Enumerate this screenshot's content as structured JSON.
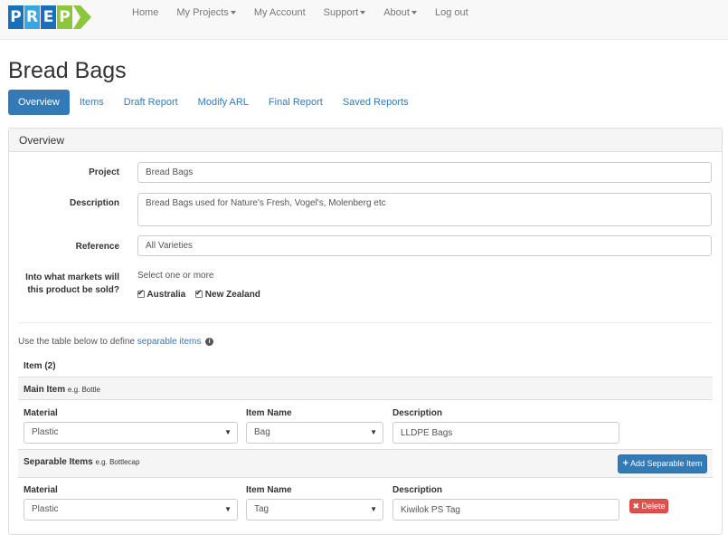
{
  "nav": {
    "logo_letters": [
      "P",
      "R",
      "E",
      "P"
    ],
    "logo_colors": [
      "#1a6fb8",
      "#3aa6dd",
      "#1a6fb8",
      "#8cc63f"
    ],
    "links": [
      {
        "label": "Home",
        "dropdown": false
      },
      {
        "label": "My Projects",
        "dropdown": true
      },
      {
        "label": "My Account",
        "dropdown": false
      },
      {
        "label": "Support",
        "dropdown": true
      },
      {
        "label": "About",
        "dropdown": true
      },
      {
        "label": "Log out",
        "dropdown": false
      }
    ]
  },
  "page": {
    "title": "Bread Bags"
  },
  "tabs": [
    "Overview",
    "Items",
    "Draft Report",
    "Modify ARL",
    "Final Report",
    "Saved Reports"
  ],
  "active_tab": 0,
  "overview": {
    "heading": "Overview",
    "project_label": "Project",
    "project_value": "Bread Bags",
    "description_label": "Description",
    "description_value": "Bread Bags used for Nature's Fresh, Vogel's, Molenberg etc",
    "reference_label": "Reference",
    "reference_value": "All Varieties",
    "markets_label_line1": "Into what markets will",
    "markets_label_line2": "this product be sold?",
    "markets_hint": "Select one or more",
    "markets": [
      {
        "label": "Australia",
        "checked": true
      },
      {
        "label": "New Zealand",
        "checked": true
      }
    ]
  },
  "items": {
    "intro_text": "Use the table below to define",
    "intro_link": "separable items",
    "count_label": "Item (2)",
    "main_item_label": "Main Item",
    "main_item_hint": "e.g. Bottle",
    "col_material": "Material",
    "col_item_name": "Item Name",
    "col_description": "Description",
    "main_row": {
      "material": "Plastic",
      "item_name": "Bag",
      "description": "LLDPE Bags"
    },
    "separable_label": "Separable Items",
    "separable_hint": "e.g. Bottlecap",
    "add_separable_button": "Add Separable Item",
    "separable_rows": [
      {
        "material": "Plastic",
        "item_name": "Tag",
        "description": "Kiwilok PS Tag",
        "delete_label": "Delete"
      }
    ]
  }
}
